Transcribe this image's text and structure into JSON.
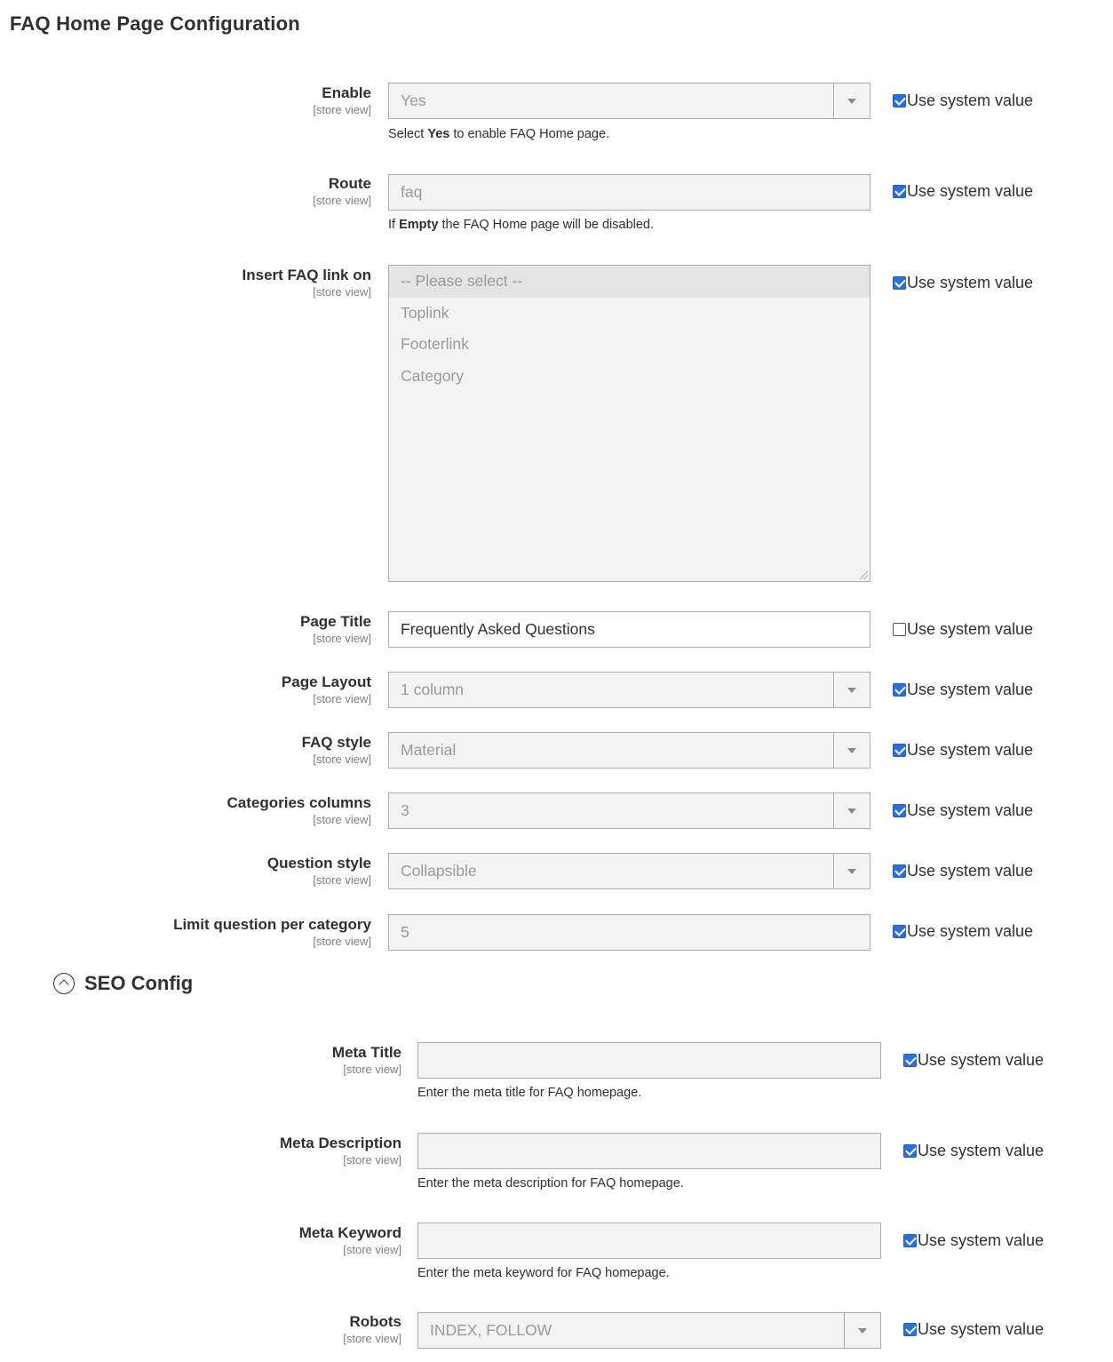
{
  "header": {
    "title": "FAQ Home Page Configuration"
  },
  "system_value_label": "Use system value",
  "fields": {
    "enable": {
      "label": "Enable",
      "scope": "[store view]",
      "value": "Yes",
      "note_pre": "Select ",
      "note_bold": "Yes",
      "note_post": " to enable FAQ Home page.",
      "use_system": true
    },
    "route": {
      "label": "Route",
      "scope": "[store view]",
      "value": "faq",
      "note_pre": "If ",
      "note_bold": "Empty",
      "note_post": " the FAQ Home page will be disabled.",
      "use_system": true
    },
    "insert_link": {
      "label": "Insert FAQ link on",
      "scope": "[store view]",
      "options": [
        "-- Please select --",
        "Toplink",
        "Footerlink",
        "Category"
      ],
      "selected": "-- Please select --",
      "use_system": true
    },
    "page_title": {
      "label": "Page Title",
      "scope": "[store view]",
      "value": "Frequently Asked Questions",
      "use_system": false
    },
    "page_layout": {
      "label": "Page Layout",
      "scope": "[store view]",
      "value": "1 column",
      "use_system": true
    },
    "faq_style": {
      "label": "FAQ style",
      "scope": "[store view]",
      "value": "Material",
      "use_system": true
    },
    "categories_columns": {
      "label": "Categories columns",
      "scope": "[store view]",
      "value": "3",
      "use_system": true
    },
    "question_style": {
      "label": "Question style",
      "scope": "[store view]",
      "value": "Collapsible",
      "use_system": true
    },
    "limit_question": {
      "label": "Limit question per category",
      "scope": "[store view]",
      "value": "5",
      "use_system": true
    }
  },
  "seo": {
    "title": "SEO Config",
    "meta_title": {
      "label": "Meta Title",
      "scope": "[store view]",
      "value": "",
      "note": "Enter the meta title for FAQ homepage.",
      "use_system": true
    },
    "meta_description": {
      "label": "Meta Description",
      "scope": "[store view]",
      "value": "",
      "note": "Enter the meta description for FAQ homepage.",
      "use_system": true
    },
    "meta_keyword": {
      "label": "Meta Keyword",
      "scope": "[store view]",
      "value": "",
      "note": "Enter the meta keyword for FAQ homepage.",
      "use_system": true
    },
    "robots": {
      "label": "Robots",
      "scope": "[store view]",
      "value": "INDEX, FOLLOW",
      "use_system": true
    }
  },
  "icons": {
    "section_toggle": "chevron-up-circle-icon",
    "select_arrow": "caret-down-icon"
  },
  "colors": {
    "checkbox_checked": "#2a6fdb",
    "disabled_field_bg": "#f3f3f3"
  }
}
